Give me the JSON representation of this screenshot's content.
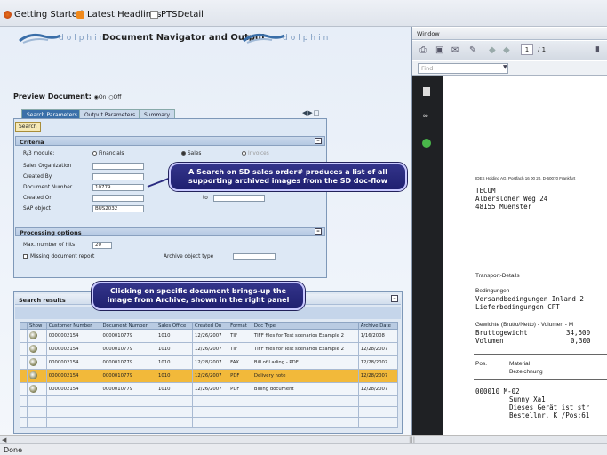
{
  "favorites": {
    "getting_started": "Getting Started",
    "latest_headlines": "Latest Headlines",
    "ptsdetail": "PTSDetail"
  },
  "header": {
    "logo_text": "dolphin",
    "title": "Document Navigator and Output"
  },
  "preview": {
    "label": "Preview Document:",
    "on": "On",
    "off": "Off"
  },
  "tabs": [
    "Search Parameters",
    "Output Parameters",
    "Summary"
  ],
  "search_button": "Search",
  "criteria": {
    "title": "Criteria",
    "rs_module_label": "R/3 module:",
    "modules": [
      "Financials",
      "Sales",
      "Invoices"
    ],
    "sales_org_label": "Sales Organization",
    "created_by_label": "Created By",
    "doc_number_label": "Document Number",
    "doc_number_value": "10779",
    "created_on_label": "Created On",
    "to_label": "to",
    "sap_object_label": "SAP object",
    "sap_object_value": "BUS2032"
  },
  "processing": {
    "title": "Processing options",
    "max_hits_label": "Max. number of hits",
    "max_hits_value": "20",
    "missing_label": "Missing document report",
    "archive_type_label": "Archive object type"
  },
  "callouts": {
    "top": "A Search on SD sales order# produces a list of all supporting archived images from the SD doc-flow",
    "bottom": "Clicking on specific document brings-up the image from Archive, shown in the right panel"
  },
  "results": {
    "title": "Search results",
    "columns": [
      "Show",
      "Customer Number",
      "Document Number",
      "Sales Office",
      "Created On",
      "Format",
      "Doc Type",
      "Archive Date"
    ],
    "rows": [
      [
        "0000002154",
        "0000010779",
        "1010",
        "12/26/2007",
        "TIF",
        "TIFF files for Test scenarios Example 2",
        "1/16/2008"
      ],
      [
        "0000002154",
        "0000010779",
        "1010",
        "12/26/2007",
        "TIF",
        "TIFF files for Test scenarios Example 2",
        "12/28/2007"
      ],
      [
        "0000002154",
        "0000010779",
        "1010",
        "12/28/2007",
        "FAX",
        "Bill of Lading - PDF",
        "12/28/2007"
      ],
      [
        "0000002154",
        "0000010779",
        "1010",
        "12/26/2007",
        "PDF",
        "Delivery note",
        "12/28/2007"
      ],
      [
        "0000002154",
        "0000010779",
        "1010",
        "12/26/2007",
        "PDF",
        "Billing document",
        "12/28/2007"
      ]
    ]
  },
  "viewer": {
    "window_label": "Window",
    "page_current": "1",
    "page_total": "/ 1",
    "find_placeholder": "Find"
  },
  "pdf": {
    "sender_line": "IDES Holding AG, Postfach 16 00 20, D-60070 Frankfurt",
    "addr1": "TECUM",
    "addr2": "Albersloher Weg 24",
    "addr3": "48155 Muenster",
    "transport": "Transport-Details",
    "bedingungen": "Bedingungen",
    "versand": "Versandbedingungen Inland 2",
    "liefer": "Lieferbedingungen CPT",
    "gewichte": "Gewichte (Brutto/Netto) - Volumen - M",
    "brutto_label": "Bruttogewicht",
    "brutto_value": "34,600",
    "volumen_label": "Volumen",
    "volumen_value": "0,300",
    "pos": "Pos.",
    "material": "Material",
    "bezeichnung": "Bezeichnung",
    "item_no": "000010 M-02",
    "item_l1": "Sunny Xa1",
    "item_l2": "Dieses Gerät ist str",
    "item_l3": "Bestellnr._K /Pos:61"
  },
  "status": "Done",
  "colors": {
    "tab_active": "#3a6fa8",
    "selected_row": "#f2b93a",
    "callout_bg": "#2a2b80"
  }
}
